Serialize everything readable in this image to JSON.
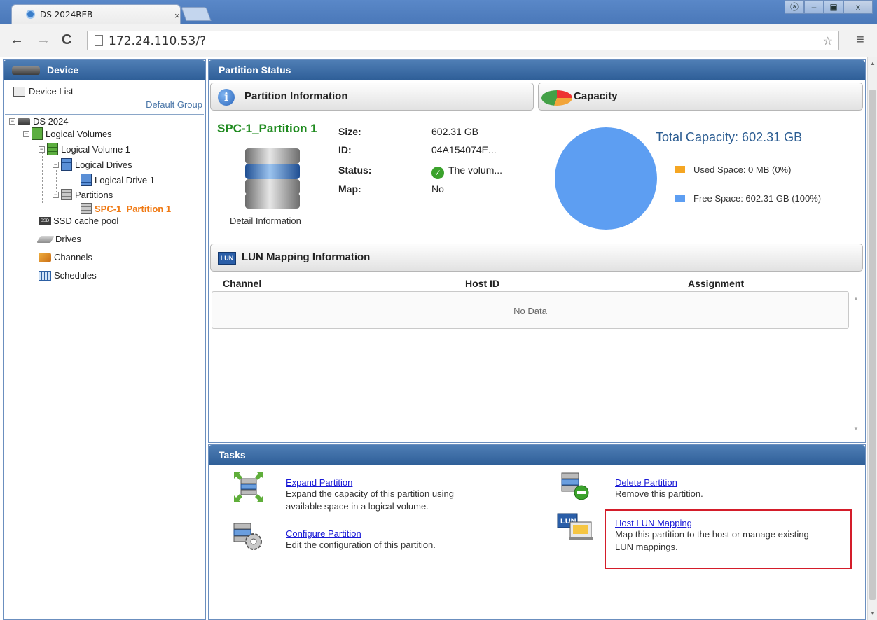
{
  "browser": {
    "tab_title": "DS 2024REB",
    "tab_close": "×",
    "url": "172.24.110.53/?",
    "window_buttons": [
      "ⓐ",
      "–",
      "▣",
      "x"
    ]
  },
  "left_panel": {
    "title": "Device",
    "device_list_label": "Device List",
    "group_label": "Default Group",
    "tree": {
      "root": "DS 2024",
      "logical_volumes": "Logical Volumes",
      "logical_volume_1": "Logical Volume 1",
      "logical_drives": "Logical Drives",
      "logical_drive_1": "Logical Drive 1",
      "partitions": "Partitions",
      "partition_selected": "SPC-1_Partition 1",
      "ssd_cache_pool": "SSD cache pool",
      "drives": "Drives",
      "channels": "Channels",
      "schedules": "Schedules"
    }
  },
  "partition_status": {
    "title": "Partition Status",
    "info_header": "Partition Information",
    "capacity_header": "Capacity",
    "partition_name": "SPC-1_Partition 1",
    "detail_link": "Detail Information",
    "fields": {
      "size_label": "Size:",
      "size_value": "602.31 GB",
      "id_label": "ID:",
      "id_value": "04A154074E...",
      "status_label": "Status:",
      "status_value": "The volum...",
      "map_label": "Map:",
      "map_value": "No"
    },
    "capacity": {
      "total": "Total Capacity: 602.31 GB",
      "used": "Used Space: 0 MB (0%)",
      "free": "Free Space: 602.31 GB (100%)",
      "used_color": "#f5a623",
      "free_color": "#5d9ef2",
      "used_fraction": 0.0,
      "free_fraction": 1.0
    },
    "lun": {
      "header": "LUN Mapping Information",
      "badge": "LUN",
      "columns": [
        "Channel",
        "Host ID",
        "Assignment"
      ],
      "empty_text": "No Data"
    }
  },
  "tasks": {
    "title": "Tasks",
    "expand": {
      "label": "Expand Partition",
      "desc_1": "Expand the capacity of this partition using",
      "desc_2": "available space in a logical volume."
    },
    "configure": {
      "label": "Configure Partition",
      "desc": "Edit the configuration of this partition."
    },
    "delete": {
      "label": "Delete Partition",
      "desc": "Remove this partition."
    },
    "host_lun": {
      "label": "Host LUN Mapping",
      "desc_1": "Map this partition to the host or manage existing",
      "desc_2": "LUN mappings."
    }
  },
  "colors": {
    "panel_header": "#3a6aa5",
    "selected_node": "#f07a14",
    "partition_name": "#1e8a1e",
    "highlight": "#d41d2a"
  }
}
